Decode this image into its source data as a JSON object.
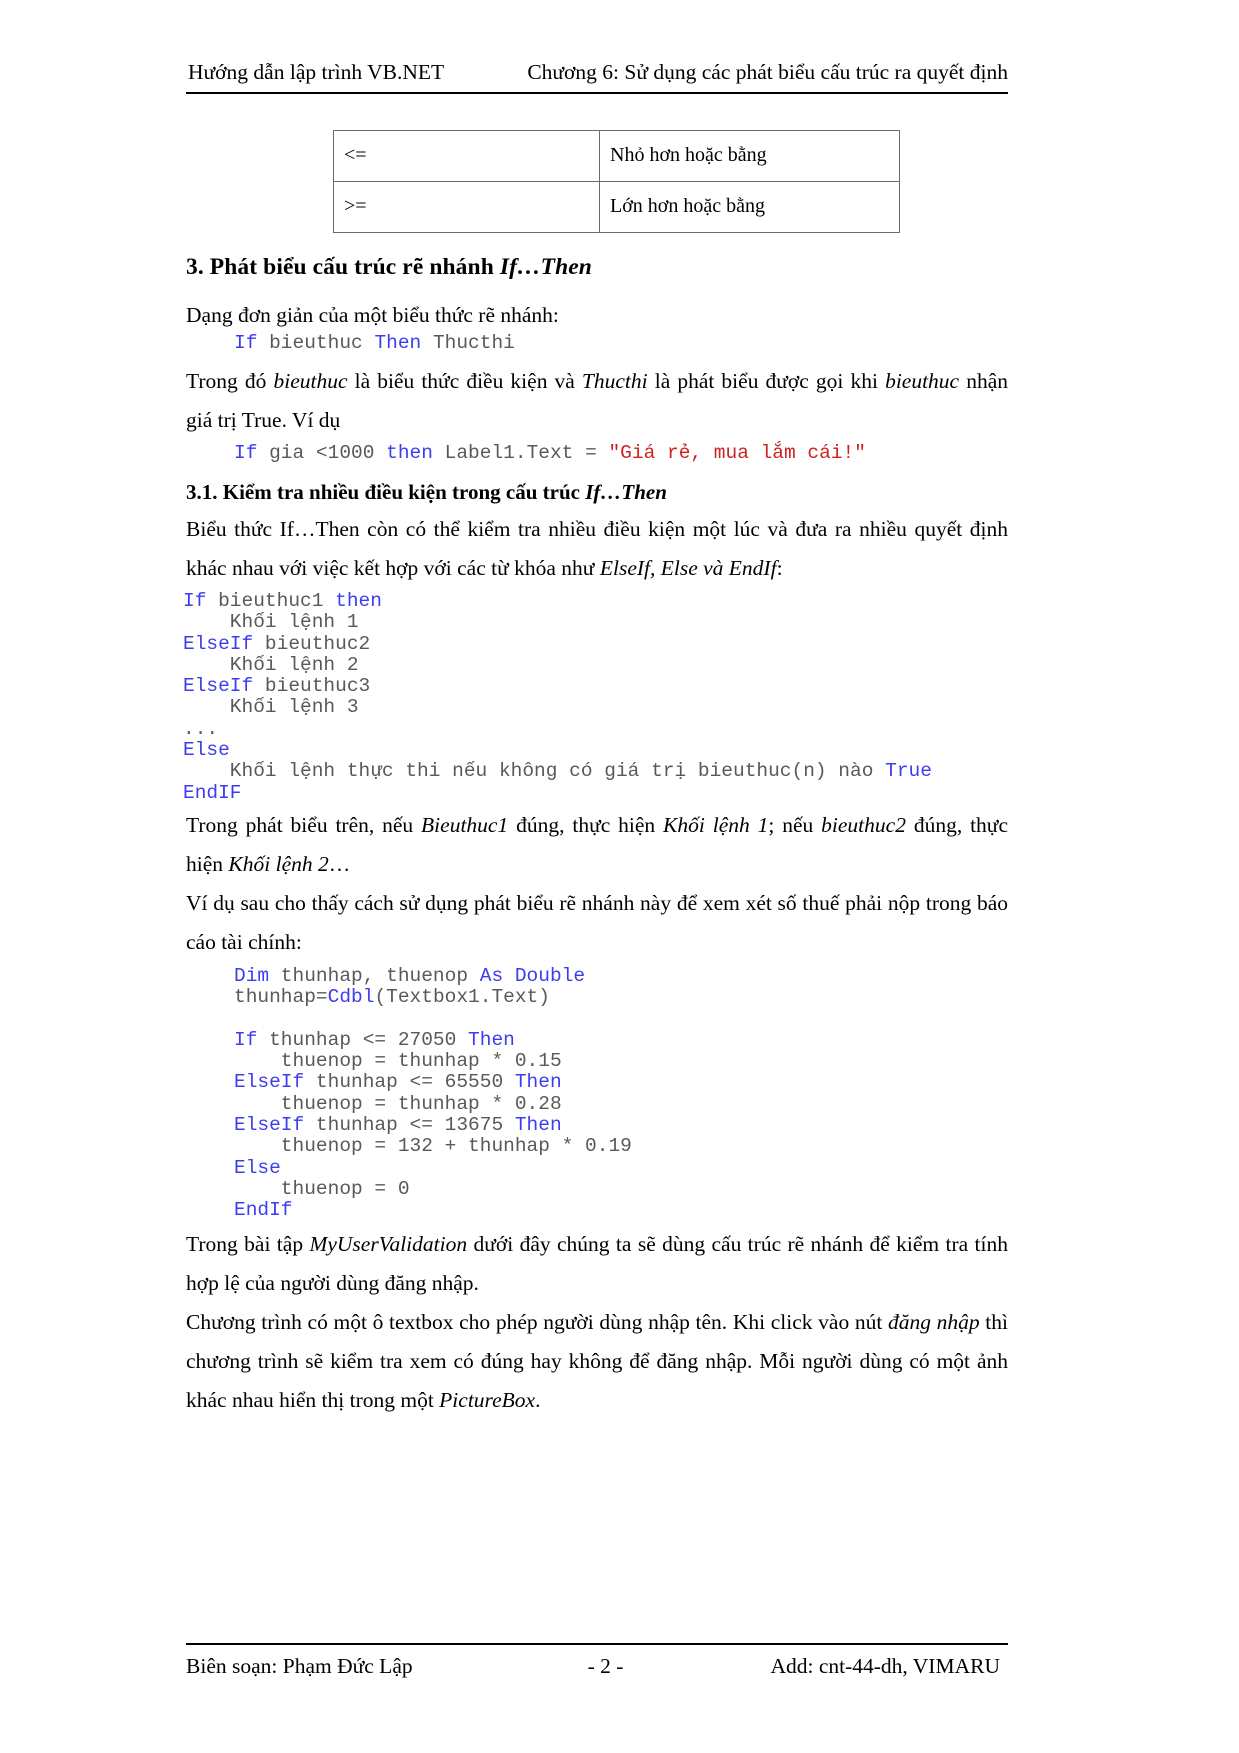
{
  "header": {
    "left": "Hướng dẫn lập trình VB.NET",
    "right": "Chương 6: Sử dụng các phát biểu cấu trúc ra quyết định"
  },
  "footer": {
    "left": "Biên soạn: Phạm Đức Lập",
    "center": "- 2 -",
    "right": "Add: cnt-44-dh, VIMARU"
  },
  "operator_table": {
    "rows": [
      {
        "symbol": "<=",
        "description": "Nhỏ hơn hoặc bằng"
      },
      {
        "symbol": ">=",
        "description": "Lớn hơn hoặc bằng"
      }
    ]
  },
  "section3": {
    "heading_plain": "3. Phát biểu cấu trúc rẽ nhánh ",
    "heading_italic": "If…Then",
    "intro": "Dạng đơn giản của một biểu thức rẽ nhánh:",
    "code1": {
      "kw_if": "If",
      "expr": " bieuthuc ",
      "kw_then": "Then",
      "tail": " Thucthi"
    },
    "para1_a": "Trong đó ",
    "para1_i1": "bieuthuc",
    "para1_b": " là biểu thức điều kiện và ",
    "para1_i2": "Thucthi",
    "para1_c": " là phát biểu được gọi khi ",
    "para1_i3": "bieuthuc",
    "para1_d": " nhận giá trị True. Ví dụ",
    "code2": {
      "kw_if": "If",
      "mid1": " gia <1000 ",
      "kw_then": "then",
      "mid2": " Label1.Text = ",
      "string": "\"Giá rẻ, mua lắm cái!\""
    }
  },
  "section31": {
    "heading_plain": "3.1. Kiểm tra nhiều điều kiện trong cấu trúc ",
    "heading_italic": "If…Then",
    "para_a": "Biểu thức If…Then còn có thể kiểm tra nhiều điều kiện một lúc và đưa ra nhiều quyết định khác nhau với việc kết hợp với các từ khóa như ",
    "para_i": "ElseIf, Else và EndIf",
    "para_b": ":",
    "code_block": [
      {
        "kw": "If",
        "rest": " bieuthuc1 ",
        "kw2": "then",
        "rest2": ""
      },
      {
        "kw": "",
        "rest": "    Khối lệnh 1",
        "kw2": "",
        "rest2": ""
      },
      {
        "kw": "ElseIf",
        "rest": " bieuthuc2",
        "kw2": "",
        "rest2": ""
      },
      {
        "kw": "",
        "rest": "    Khối lệnh 2",
        "kw2": "",
        "rest2": ""
      },
      {
        "kw": "ElseIf",
        "rest": " bieuthuc3",
        "kw2": "",
        "rest2": ""
      },
      {
        "kw": "",
        "rest": "    Khối lệnh 3",
        "kw2": "",
        "rest2": ""
      },
      {
        "kw": "",
        "rest": "...",
        "kw2": "",
        "rest2": ""
      },
      {
        "kw": "Else",
        "rest": "",
        "kw2": "",
        "rest2": ""
      },
      {
        "kw": "",
        "rest": "    Khối lệnh thực thi nếu không có giá trị bieuthuc(n) nào ",
        "kw2": "True",
        "rest2": ""
      },
      {
        "kw": "EndIF",
        "rest": "",
        "kw2": "",
        "rest2": ""
      }
    ],
    "para2_a": "Trong phát biểu trên, nếu ",
    "para2_i1": "Bieuthuc1",
    "para2_b": " đúng, thực hiện ",
    "para2_i2": "Khối lệnh 1",
    "para2_c": "; nếu ",
    "para2_i3": "bieuthuc2",
    "para2_d": " đúng, thực hiện ",
    "para2_i4": "Khối lệnh 2",
    "para2_e": "…",
    "para3": "Ví dụ sau cho thấy cách sử dụng phát biểu rẽ nhánh này để xem xét số thuế phải nộp trong báo cáo tài chính:",
    "code_block2": [
      "Dim thunhap, thuenop As Double",
      "thunhap=Cdbl(Textbox1.Text)",
      "",
      "If thunhap <= 27050 Then",
      "    thuenop = thunhap * 0.15",
      "ElseIf thunhap <= 65550 Then",
      "    thuenop = thunhap * 0.28",
      "ElseIf thunhap <= 13675 Then",
      "    thuenop = 132 + thunhap * 0.19",
      "Else",
      "    thuenop = 0",
      "EndIf"
    ],
    "para4_a": "Trong bài tập ",
    "para4_i": "MyUserValidation",
    "para4_b": " dưới đây chúng ta sẽ dùng cấu trúc rẽ nhánh để kiểm tra tính hợp lệ của người dùng đăng nhập.",
    "para5_a": "Chương trình có một ô textbox cho phép người dùng nhập tên. Khi click vào nút ",
    "para5_i1": "đăng nhập",
    "para5_b": " thì chương trình sẽ kiểm tra xem có đúng hay không để đăng nhập. Mỗi người dùng có một ảnh khác nhau hiển thị trong một ",
    "para5_i2": "PictureBox",
    "para5_c": "."
  },
  "colors": {
    "keyword": "#3d3df0",
    "code_text": "#595959",
    "string": "#cc2222",
    "rule": "#000000",
    "table_border": "#6b6b6b"
  }
}
